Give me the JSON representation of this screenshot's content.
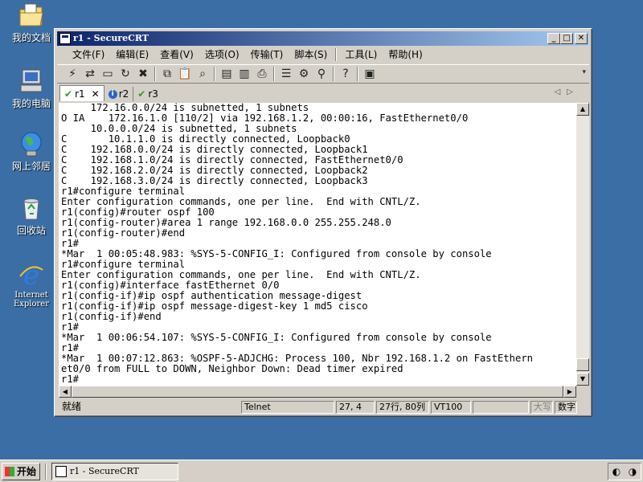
{
  "desktop": {
    "icons": [
      {
        "label": "我的文档"
      },
      {
        "label": "我的电脑"
      },
      {
        "label": "网上邻居"
      },
      {
        "label": "回收站"
      },
      {
        "label": "Internet Explorer"
      }
    ]
  },
  "window": {
    "title": "r1 - SecureCRT",
    "menu": [
      "文件(F)",
      "编辑(E)",
      "查看(V)",
      "选项(O)",
      "传输(T)",
      "脚本(S)",
      "工具(L)",
      "帮助(H)"
    ],
    "tabs": [
      {
        "label": "r1",
        "status": "connected"
      },
      {
        "label": "r2",
        "status": "info"
      },
      {
        "label": "r3",
        "status": "connected"
      }
    ],
    "terminal_lines": [
      "     172.16.0.0/24 is subnetted, 1 subnets",
      "O IA    172.16.1.0 [110/2] via 192.168.1.2, 00:00:16, FastEthernet0/0",
      "     10.0.0.0/24 is subnetted, 1 subnets",
      "C       10.1.1.0 is directly connected, Loopback0",
      "C    192.168.0.0/24 is directly connected, Loopback1",
      "C    192.168.1.0/24 is directly connected, FastEthernet0/0",
      "C    192.168.2.0/24 is directly connected, Loopback2",
      "C    192.168.3.0/24 is directly connected, Loopback3",
      "r1#configure terminal",
      "Enter configuration commands, one per line.  End with CNTL/Z.",
      "r1(config)#router ospf 100",
      "r1(config-router)#area 1 range 192.168.0.0 255.255.248.0",
      "r1(config-router)#end",
      "r1#",
      "*Mar  1 00:05:48.983: %SYS-5-CONFIG_I: Configured from console by console",
      "r1#configure terminal",
      "Enter configuration commands, one per line.  End with CNTL/Z.",
      "r1(config)#interface fastEthernet 0/0",
      "r1(config-if)#ip ospf authentication message-digest",
      "r1(config-if)#ip ospf message-digest-key 1 md5 cisco",
      "r1(config-if)#end",
      "r1#",
      "*Mar  1 00:06:54.107: %SYS-5-CONFIG_I: Configured from console by console",
      "r1#",
      "*Mar  1 00:07:12.863: %OSPF-5-ADJCHG: Process 100, Nbr 192.168.1.2 on FastEthern",
      "et0/0 from FULL to DOWN, Neighbor Down: Dead timer expired",
      "r1#"
    ],
    "status": {
      "ready": "就绪",
      "protocol": "Telnet",
      "cursor": "27,  4",
      "size": "27行, 80列",
      "emulation": "VT100",
      "blank": "",
      "caps": "大写",
      "num": "数字"
    }
  },
  "taskbar": {
    "start_label": "开始",
    "task_label": "r1 - SecureCRT"
  }
}
